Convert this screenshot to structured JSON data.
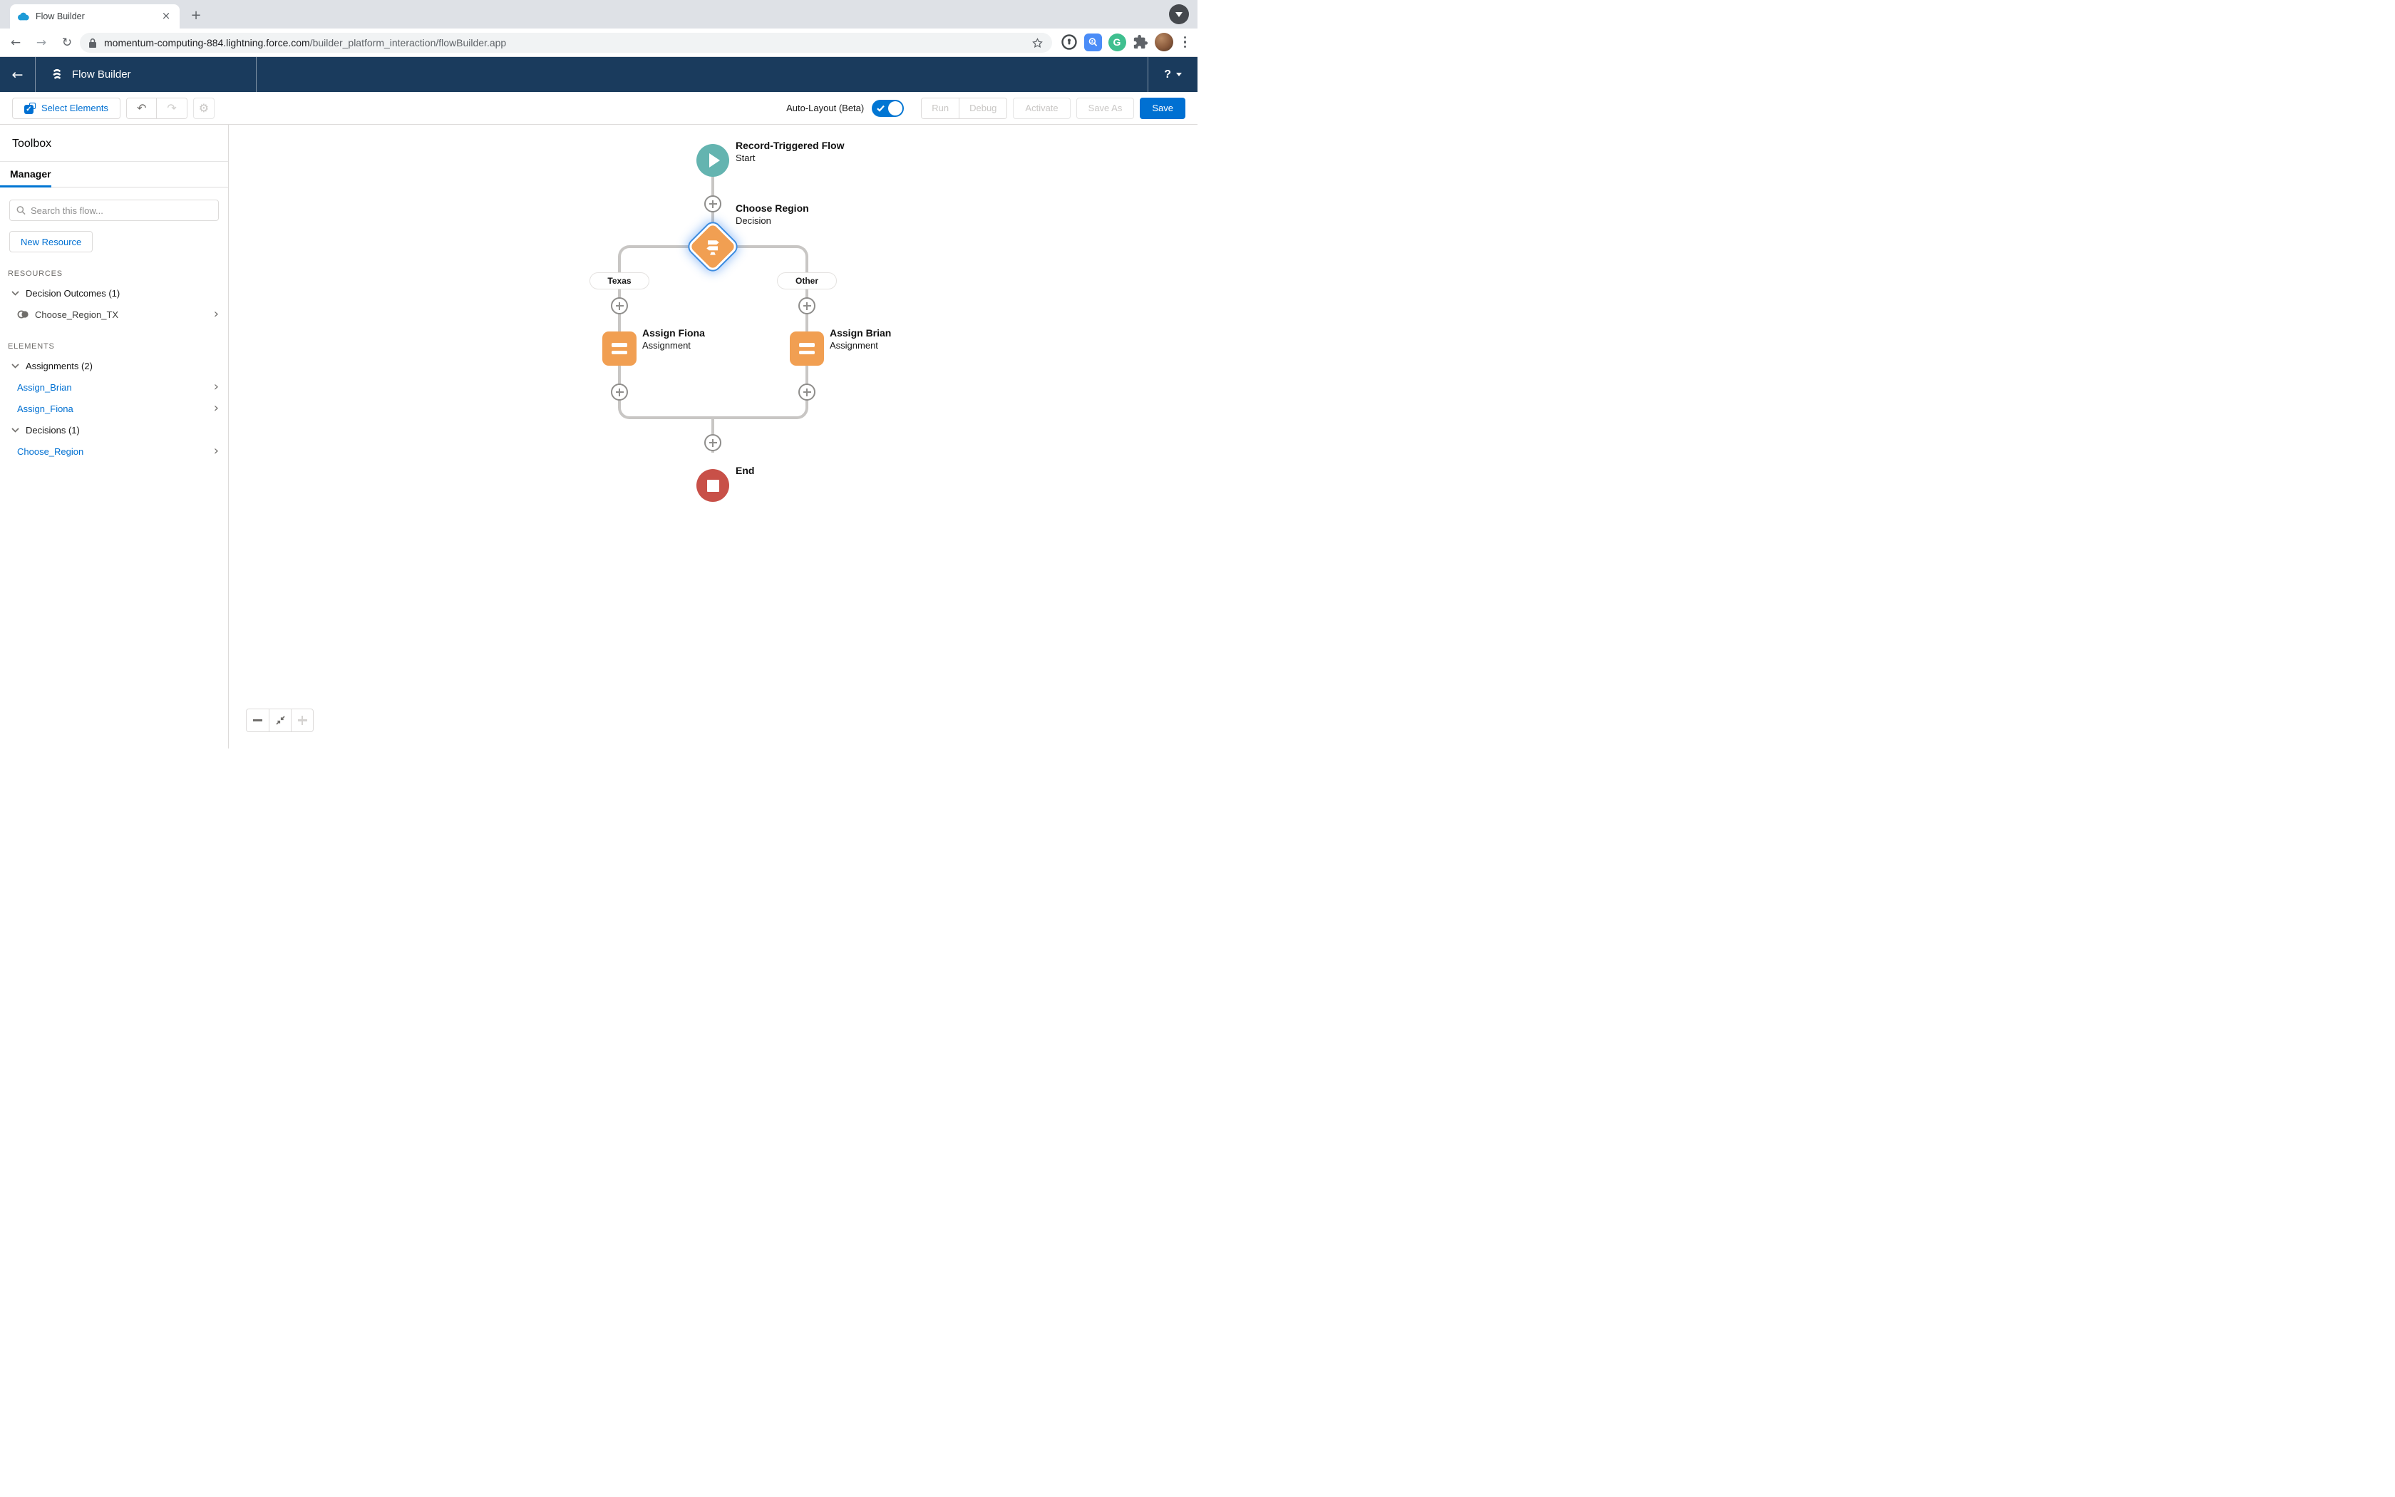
{
  "browser": {
    "tab_title": "Flow Builder",
    "new_tab_label": "+",
    "url_domain": "momentum-computing-884.lightning.force.com",
    "url_path": "/builder_platform_interaction/flowBuilder.app"
  },
  "app_header": {
    "back_label": "←",
    "title": "Flow Builder",
    "help_label": "?"
  },
  "flow_toolbar": {
    "select_elements": "Select Elements",
    "undo_label": "↶",
    "redo_label": "↷",
    "settings_label": "⚙",
    "auto_layout": "Auto-Layout (Beta)",
    "run": "Run",
    "debug": "Debug",
    "activate": "Activate",
    "save_as": "Save As",
    "save": "Save"
  },
  "toolbox": {
    "title": "Toolbox",
    "manager_tab": "Manager",
    "search_placeholder": "Search this flow...",
    "new_resource": "New Resource",
    "resources_heading": "RESOURCES",
    "decision_outcomes": {
      "label": "Decision Outcomes (1)",
      "items": [
        {
          "label": "Choose_Region_TX"
        }
      ]
    },
    "elements_heading": "ELEMENTS",
    "assignments": {
      "label": "Assignments (2)",
      "items": [
        {
          "label": "Assign_Brian"
        },
        {
          "label": "Assign_Fiona"
        }
      ]
    },
    "decisions": {
      "label": "Decisions (1)",
      "items": [
        {
          "label": "Choose_Region"
        }
      ]
    }
  },
  "canvas": {
    "start": {
      "title": "Record-Triggered Flow",
      "subtitle": "Start"
    },
    "decision": {
      "title": "Choose Region",
      "subtitle": "Decision"
    },
    "branches": [
      "Texas",
      "Other"
    ],
    "assignments": [
      {
        "title": "Assign Fiona",
        "subtitle": "Assignment"
      },
      {
        "title": "Assign Brian",
        "subtitle": "Assignment"
      }
    ],
    "end": {
      "title": "End"
    }
  },
  "colors": {
    "navy_header": "#1a3b5d",
    "accent_blue": "#0070d2",
    "toggle_blue": "#0176d3",
    "node_teal": "#64b4b0",
    "node_orange": "#f19f52",
    "node_red": "#c85048",
    "connector_gray": "#c8c6c4",
    "selection_glow": "#3d8ce0"
  }
}
